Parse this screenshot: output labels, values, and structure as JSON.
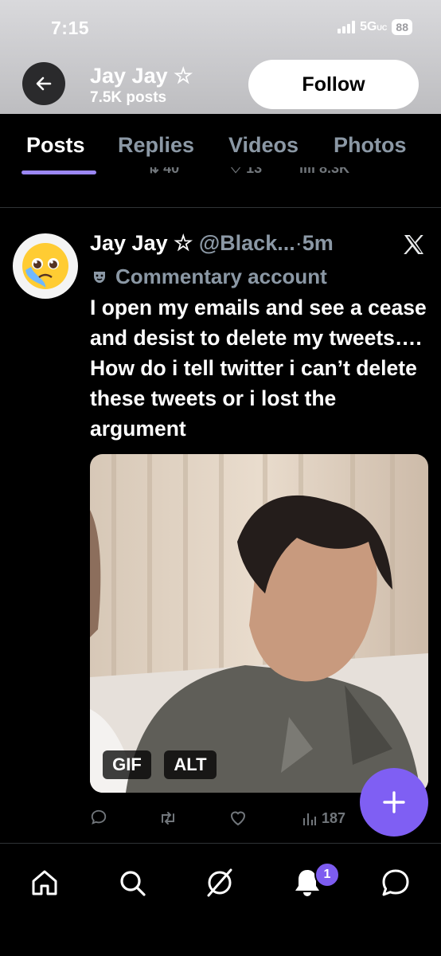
{
  "status_bar": {
    "time": "7:15",
    "network": "5G",
    "network_sub": "UC",
    "battery": "88"
  },
  "profile": {
    "name": "Jay Jay ☆",
    "posts_count": "7.5K posts",
    "follow_label": "Follow"
  },
  "tabs": [
    {
      "label": "Posts",
      "active": true
    },
    {
      "label": "Replies",
      "active": false
    },
    {
      "label": "Videos",
      "active": false
    },
    {
      "label": "Photos",
      "active": false
    }
  ],
  "previous_post": {
    "retweets": "40",
    "likes": "13",
    "views": "8.3K"
  },
  "tweet": {
    "name": "Jay Jay ☆",
    "handle": "@Black...",
    "separator": "·",
    "time": "5m",
    "label_icon": "theater-masks-icon",
    "label": "Commentary account",
    "text": "I open my emails and see a cease and desist to delete my tweets…. How do i tell twitter i can’t delete these tweets or i lost the argument",
    "media_badges": {
      "gif": "GIF",
      "alt": "ALT"
    },
    "stats": {
      "views": "187"
    }
  },
  "bottom_nav": {
    "items": [
      "home-icon",
      "search-icon",
      "grok-icon",
      "notifications-icon",
      "messages-icon"
    ],
    "notification_count": "1"
  },
  "colors": {
    "accent": "#7f5ff3",
    "tab_indicator": "#9b87f5",
    "muted": "#8b98a5"
  }
}
